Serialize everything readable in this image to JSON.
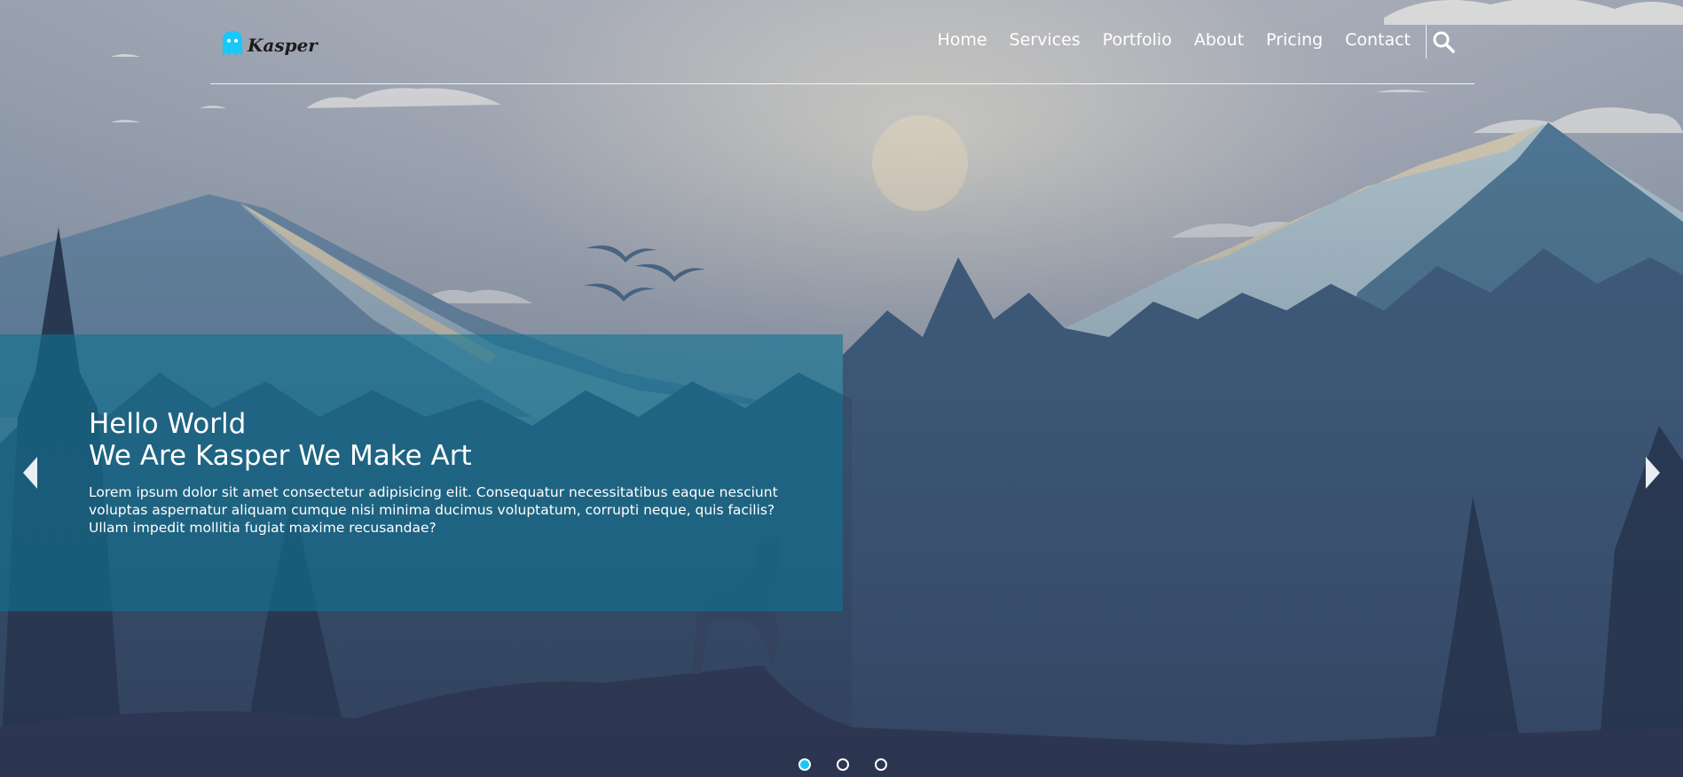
{
  "page": {
    "title": "Kasper"
  },
  "logo": {
    "text": "Kasper",
    "color": "#19c8fa",
    "icon": "ghost-icon"
  },
  "nav": {
    "items": [
      {
        "label": "Home"
      },
      {
        "label": "Services"
      },
      {
        "label": "Portfolio"
      },
      {
        "label": "About"
      },
      {
        "label": "Pricing"
      },
      {
        "label": "Contact"
      }
    ],
    "search_icon": "search-icon"
  },
  "hero": {
    "heading_line1": "Hello World",
    "heading_line2": "We Are Kasper We Make Art",
    "text": "Lorem ipsum dolor sit amet consectetur adipisicing elit. Consequatur necessitatibus eaque nesciunt voluptas aspernatur aliquam cumque nisi minima ducimus voluptatum, corrupti neque, quis facilis? Ullam impedit mollitia fugiat maxime recusandae?",
    "prev_icon": "caret-left-icon",
    "next_icon": "caret-right-icon",
    "slides": {
      "count": 3,
      "active": 1
    }
  },
  "colors": {
    "accent": "#19c8fa",
    "overlay": "#107391"
  }
}
